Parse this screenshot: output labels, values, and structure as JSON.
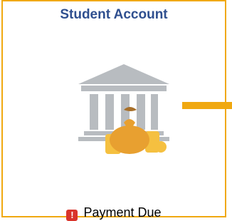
{
  "tile": {
    "title": "Student Account",
    "icon": "bank-money-bag-icon",
    "status": {
      "icon": "alert-icon",
      "icon_glyph": "!",
      "label": "Payment Due"
    }
  },
  "colors": {
    "border": "#f0a810",
    "title": "#2f4f8f",
    "bank": "#b8bcc0",
    "coin": "#f5c040",
    "bag": "#e8a030",
    "alert": "#d9342b"
  }
}
